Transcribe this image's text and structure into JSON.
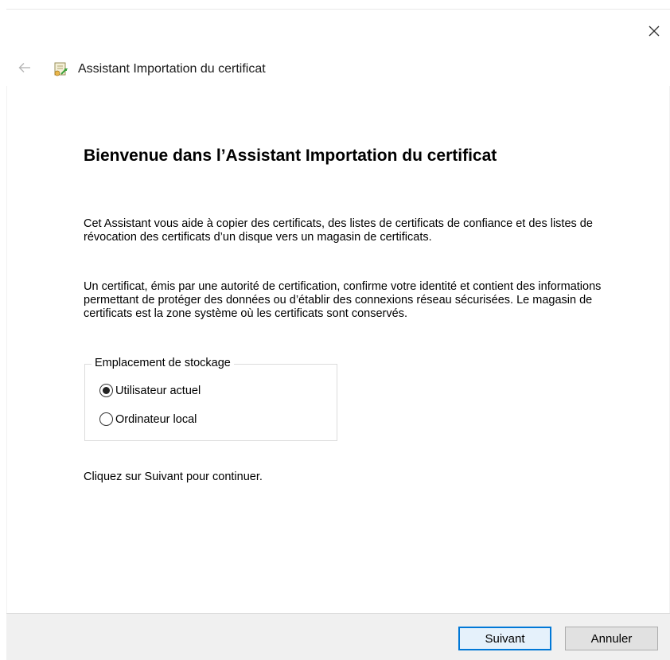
{
  "window": {
    "title": "Assistant Importation du certificat"
  },
  "icons": {
    "close": "close-icon",
    "back": "back-arrow-icon",
    "wizard": "certificate-wizard-icon"
  },
  "main": {
    "heading": "Bienvenue dans l’Assistant Importation du certificat",
    "paragraph1": "Cet Assistant vous aide à copier des certificats, des listes de certificats de confiance et des listes de révocation des certificats d’un disque vers un magasin de certificats.",
    "paragraph2": "Un certificat, émis par une autorité de certification, confirme votre identité et contient des informations permettant de protéger des données ou d’établir des connexions réseau sécurisées. Le magasin de certificats est la zone système où les certificats sont conservés.",
    "storage": {
      "legend": "Emplacement de stockage",
      "options": [
        {
          "label": "Utilisateur actuel",
          "selected": true
        },
        {
          "label": "Ordinateur local",
          "selected": false
        }
      ]
    },
    "paragraph3": "Cliquez sur Suivant pour continuer."
  },
  "footer": {
    "next_label": "Suivant",
    "cancel_label": "Annuler"
  },
  "colors": {
    "accent": "#0078d7",
    "footer_bg": "#f0f0f0",
    "button_bg": "#e1e1e1"
  }
}
